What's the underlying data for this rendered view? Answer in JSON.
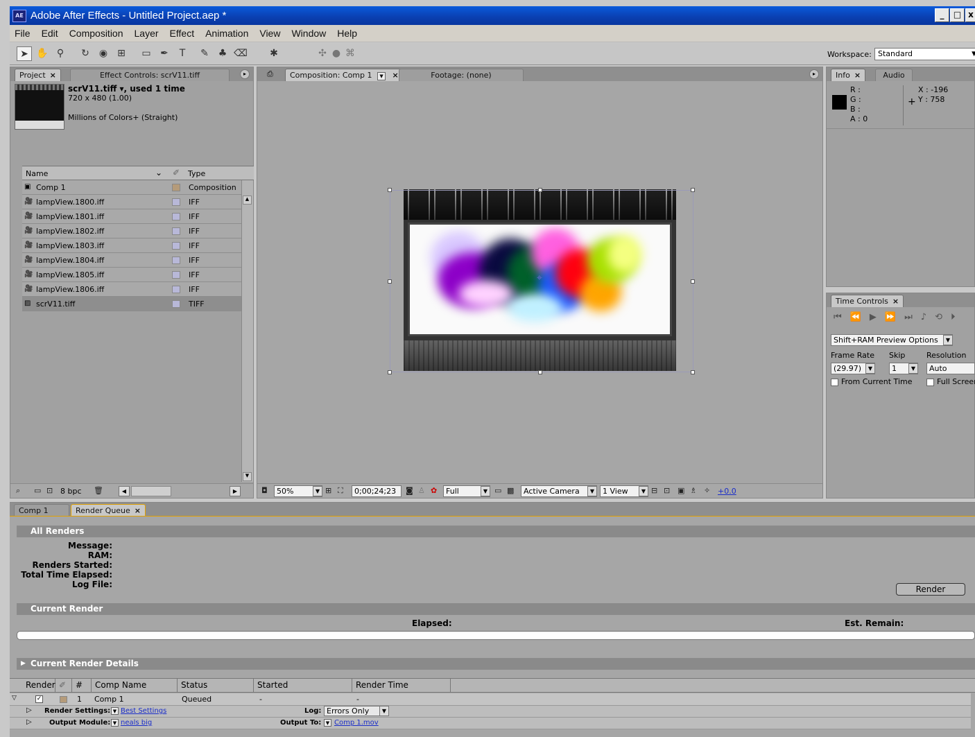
{
  "window": {
    "title": "Adobe After Effects - Untitled Project.aep *",
    "app_icon": "AE",
    "buttons": [
      "_",
      "□",
      "x"
    ]
  },
  "menu": [
    "File",
    "Edit",
    "Composition",
    "Layer",
    "Effect",
    "Animation",
    "View",
    "Window",
    "Help"
  ],
  "toolbar": {
    "workspace_label": "Workspace:",
    "workspace_value": "Standard"
  },
  "project_panel": {
    "tab_project": "Project",
    "tab_effect_controls": "Effect Controls: scrV11.tiff",
    "selected_name": "scrV11.tiff ▾, used 1 time",
    "dimensions": "720 x 480 (1.00)",
    "colors": "Millions of Colors+ (Straight)",
    "col_name": "Name",
    "col_type": "Type",
    "items": [
      {
        "name": "Comp 1",
        "type": "Composition",
        "icon": "comp-icon",
        "swatch": "#b59b7a"
      },
      {
        "name": "lampView.1800.iff",
        "type": "IFF",
        "icon": "footage-icon",
        "swatch": "#b8b8d8"
      },
      {
        "name": "lampView.1801.iff",
        "type": "IFF",
        "icon": "footage-icon",
        "swatch": "#b8b8d8"
      },
      {
        "name": "lampView.1802.iff",
        "type": "IFF",
        "icon": "footage-icon",
        "swatch": "#b8b8d8"
      },
      {
        "name": "lampView.1803.iff",
        "type": "IFF",
        "icon": "footage-icon",
        "swatch": "#b8b8d8"
      },
      {
        "name": "lampView.1804.iff",
        "type": "IFF",
        "icon": "footage-icon",
        "swatch": "#b8b8d8"
      },
      {
        "name": "lampView.1805.iff",
        "type": "IFF",
        "icon": "footage-icon",
        "swatch": "#b8b8d8"
      },
      {
        "name": "lampView.1806.iff",
        "type": "IFF",
        "icon": "footage-icon",
        "swatch": "#b8b8d8"
      },
      {
        "name": "scrV11.tiff",
        "type": "TIFF",
        "icon": "image-icon",
        "swatch": "#b8b8d8"
      }
    ],
    "bpc": "8 bpc"
  },
  "composition_panel": {
    "tab_comp": "Composition: Comp 1",
    "tab_footage": "Footage: (none)",
    "zoom": "50%",
    "timecode": "0;00;24;23",
    "resolution": "Full",
    "camera": "Active Camera",
    "views": "1 View",
    "exposure": "+0.0"
  },
  "info_panel": {
    "tab_info": "Info",
    "tab_audio": "Audio",
    "r": "R :",
    "g": "G :",
    "b": "B :",
    "a": "A : 0",
    "x": "X : -196",
    "y": "Y : 758"
  },
  "time_controls": {
    "tab": "Time Controls",
    "preview_options": "Shift+RAM Preview Options",
    "frame_rate_label": "Frame Rate",
    "skip_label": "Skip",
    "resolution_label": "Resolution",
    "frame_rate_value": "(29.97)",
    "skip_value": "1",
    "resolution_value": "Auto",
    "from_current_time": "From Current Time",
    "full_screen": "Full Screen"
  },
  "render_queue": {
    "tab_comp": "Comp 1",
    "tab_rq": "Render Queue",
    "all_renders": "All Renders",
    "message": "Message:",
    "ram": "RAM:",
    "renders_started": "Renders Started:",
    "total_time": "Total Time Elapsed:",
    "log_file": "Log File:",
    "render_button": "Render",
    "current_render": "Current Render",
    "elapsed": "Elapsed:",
    "est_remain": "Est. Remain:",
    "current_render_details": "Current Render Details",
    "columns": [
      "Render",
      "#",
      "Comp Name",
      "Status",
      "Started",
      "Render Time"
    ],
    "row": {
      "num": "1",
      "comp": "Comp 1",
      "status": "Queued",
      "started": "-",
      "render_time": "-"
    },
    "render_settings_label": "Render Settings:",
    "render_settings_value": "Best Settings",
    "log_label": "Log:",
    "log_value": "Errors Only",
    "output_module_label": "Output Module:",
    "output_module_value": "neals big",
    "output_to_label": "Output To:",
    "output_to_value": "Comp 1.mov"
  }
}
